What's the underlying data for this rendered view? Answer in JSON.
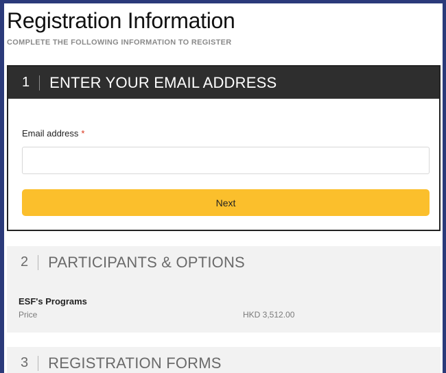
{
  "header": {
    "title": "Registration Information",
    "subtitle": "COMPLETE THE FOLLOWING INFORMATION TO REGISTER"
  },
  "step1": {
    "number": "1",
    "title": "ENTER YOUR EMAIL ADDRESS",
    "email_label": "Email address",
    "required_mark": "*",
    "email_value": "",
    "email_placeholder": "",
    "next_label": "Next"
  },
  "step2": {
    "number": "2",
    "title": "PARTICIPANTS & OPTIONS",
    "program_name": "ESF's Programs",
    "price_label": "Price",
    "price_value": "HKD 3,512.00"
  },
  "step3": {
    "number": "3",
    "title": "REGISTRATION FORMS"
  },
  "colors": {
    "accent_button": "#fbbf2c",
    "active_header": "#2e2e2e",
    "frame_border": "#2b3a7a",
    "required": "#d9331a"
  }
}
